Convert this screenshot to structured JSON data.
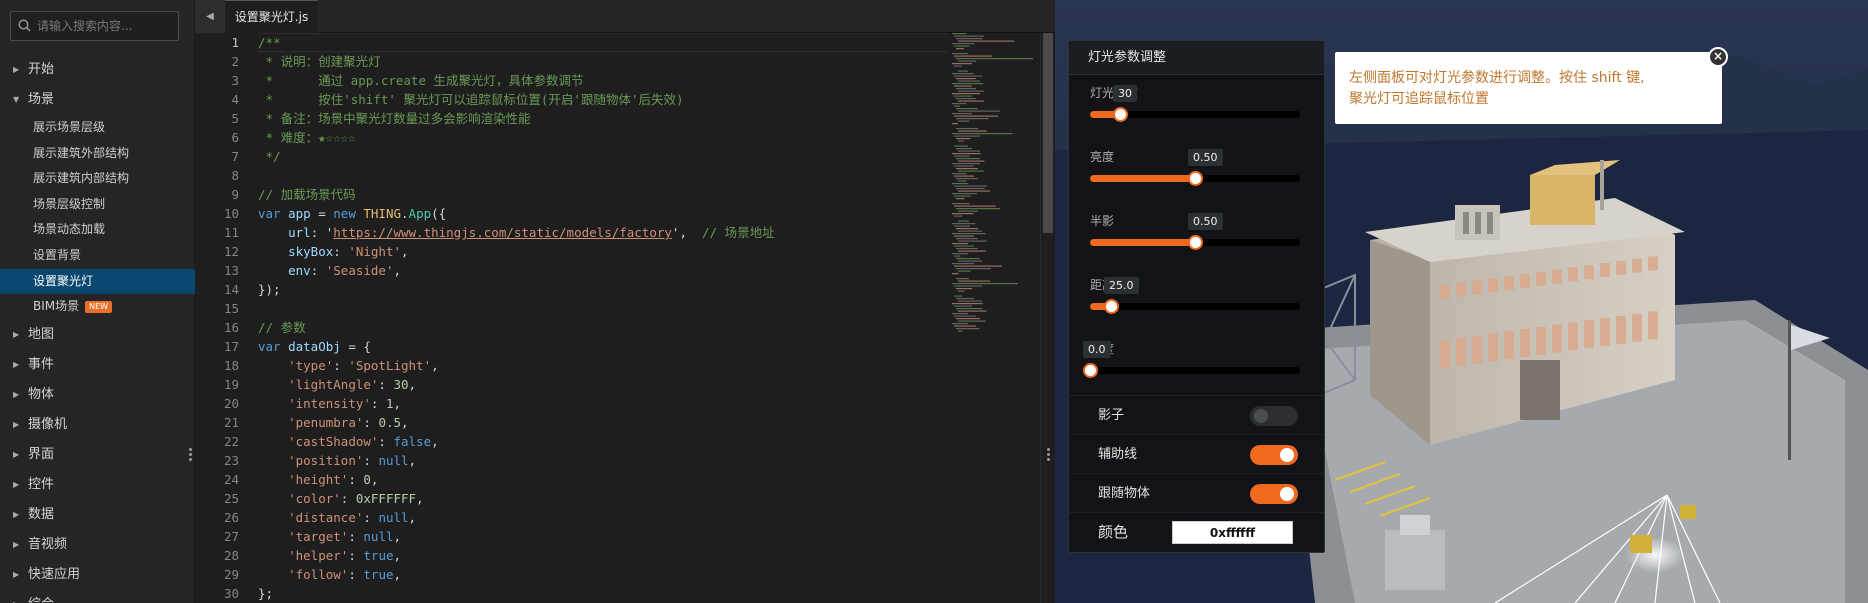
{
  "search": {
    "placeholder": "请输入搜索内容..."
  },
  "sidebar": {
    "items": [
      {
        "label": "开始",
        "caret": "▶"
      },
      {
        "label": "场景",
        "caret": "▼"
      },
      {
        "label": "地图",
        "caret": "▶"
      },
      {
        "label": "事件",
        "caret": "▶"
      },
      {
        "label": "物体",
        "caret": "▶"
      },
      {
        "label": "摄像机",
        "caret": "▶"
      },
      {
        "label": "界面",
        "caret": "▶"
      },
      {
        "label": "控件",
        "caret": "▶"
      },
      {
        "label": "数据",
        "caret": "▶"
      },
      {
        "label": "音视频",
        "caret": "▶"
      },
      {
        "label": "快速应用",
        "caret": "▶"
      },
      {
        "label": "综合",
        "caret": "▶"
      }
    ],
    "subitems": [
      {
        "label": "展示场景层级"
      },
      {
        "label": "展示建筑外部结构"
      },
      {
        "label": "展示建筑内部结构"
      },
      {
        "label": "场景层级控制"
      },
      {
        "label": "场景动态加载"
      },
      {
        "label": "设置背景"
      },
      {
        "label": "设置聚光灯"
      },
      {
        "label": "BIM场景",
        "badge": "NEW"
      }
    ]
  },
  "editor": {
    "tab_arrow": "◀",
    "tab_label": "设置聚光灯.js",
    "line_numbers": [
      "1",
      "2",
      "3",
      "4",
      "5",
      "6",
      "7",
      "8",
      "9",
      "10",
      "11",
      "12",
      "13",
      "14",
      "15",
      "16",
      "17",
      "18",
      "19",
      "20",
      "21",
      "22",
      "23",
      "24",
      "25",
      "26",
      "27",
      "28",
      "29",
      "30"
    ]
  },
  "panel": {
    "title": "灯光参数调整",
    "sliders": [
      {
        "label": "灯光角度",
        "value": "30",
        "fraction": 0.143
      },
      {
        "label": "亮度",
        "value": "0.50",
        "fraction": 0.5
      },
      {
        "label": "半影",
        "value": "0.50",
        "fraction": 0.5
      },
      {
        "label": "距离",
        "value": "25.0",
        "fraction": 0.1
      },
      {
        "label": "高度",
        "value": "0.0",
        "fraction": 0.0
      }
    ],
    "toggles": [
      {
        "label": "影子",
        "state": "off"
      },
      {
        "label": "辅助线",
        "state": "on"
      },
      {
        "label": "跟随物体",
        "state": "on"
      }
    ],
    "color": {
      "label": "颜色",
      "value": "0xffffff"
    }
  },
  "tooltip": {
    "line1": "左侧面板可对灯光参数进行调整。按住 shift 键,",
    "line2": "聚光灯可追踪鼠标位置",
    "close": "×"
  },
  "colors": {
    "accent": "#ef6a1f",
    "active_nav": "#094771"
  }
}
